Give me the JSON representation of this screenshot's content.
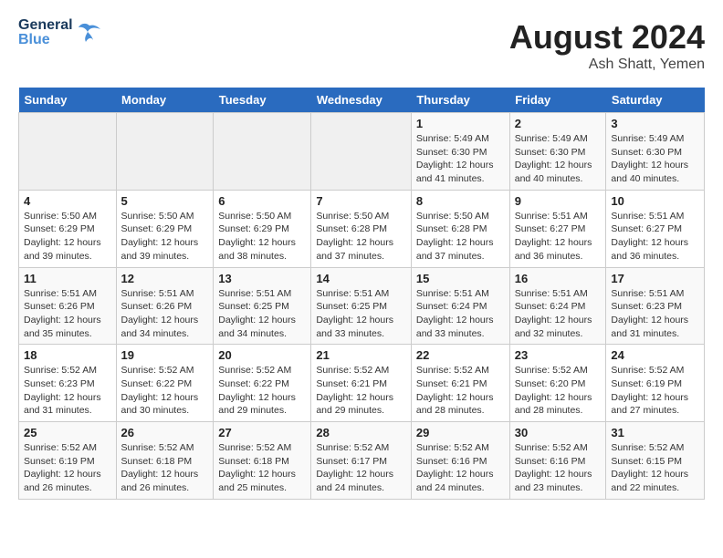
{
  "header": {
    "logo_general": "General",
    "logo_blue": "Blue",
    "month_year": "August 2024",
    "location": "Ash Shatt, Yemen"
  },
  "days_of_week": [
    "Sunday",
    "Monday",
    "Tuesday",
    "Wednesday",
    "Thursday",
    "Friday",
    "Saturday"
  ],
  "weeks": [
    [
      {
        "day": "",
        "info": ""
      },
      {
        "day": "",
        "info": ""
      },
      {
        "day": "",
        "info": ""
      },
      {
        "day": "",
        "info": ""
      },
      {
        "day": "1",
        "info": "Sunrise: 5:49 AM\nSunset: 6:30 PM\nDaylight: 12 hours\nand 41 minutes."
      },
      {
        "day": "2",
        "info": "Sunrise: 5:49 AM\nSunset: 6:30 PM\nDaylight: 12 hours\nand 40 minutes."
      },
      {
        "day": "3",
        "info": "Sunrise: 5:49 AM\nSunset: 6:30 PM\nDaylight: 12 hours\nand 40 minutes."
      }
    ],
    [
      {
        "day": "4",
        "info": "Sunrise: 5:50 AM\nSunset: 6:29 PM\nDaylight: 12 hours\nand 39 minutes."
      },
      {
        "day": "5",
        "info": "Sunrise: 5:50 AM\nSunset: 6:29 PM\nDaylight: 12 hours\nand 39 minutes."
      },
      {
        "day": "6",
        "info": "Sunrise: 5:50 AM\nSunset: 6:29 PM\nDaylight: 12 hours\nand 38 minutes."
      },
      {
        "day": "7",
        "info": "Sunrise: 5:50 AM\nSunset: 6:28 PM\nDaylight: 12 hours\nand 37 minutes."
      },
      {
        "day": "8",
        "info": "Sunrise: 5:50 AM\nSunset: 6:28 PM\nDaylight: 12 hours\nand 37 minutes."
      },
      {
        "day": "9",
        "info": "Sunrise: 5:51 AM\nSunset: 6:27 PM\nDaylight: 12 hours\nand 36 minutes."
      },
      {
        "day": "10",
        "info": "Sunrise: 5:51 AM\nSunset: 6:27 PM\nDaylight: 12 hours\nand 36 minutes."
      }
    ],
    [
      {
        "day": "11",
        "info": "Sunrise: 5:51 AM\nSunset: 6:26 PM\nDaylight: 12 hours\nand 35 minutes."
      },
      {
        "day": "12",
        "info": "Sunrise: 5:51 AM\nSunset: 6:26 PM\nDaylight: 12 hours\nand 34 minutes."
      },
      {
        "day": "13",
        "info": "Sunrise: 5:51 AM\nSunset: 6:25 PM\nDaylight: 12 hours\nand 34 minutes."
      },
      {
        "day": "14",
        "info": "Sunrise: 5:51 AM\nSunset: 6:25 PM\nDaylight: 12 hours\nand 33 minutes."
      },
      {
        "day": "15",
        "info": "Sunrise: 5:51 AM\nSunset: 6:24 PM\nDaylight: 12 hours\nand 33 minutes."
      },
      {
        "day": "16",
        "info": "Sunrise: 5:51 AM\nSunset: 6:24 PM\nDaylight: 12 hours\nand 32 minutes."
      },
      {
        "day": "17",
        "info": "Sunrise: 5:51 AM\nSunset: 6:23 PM\nDaylight: 12 hours\nand 31 minutes."
      }
    ],
    [
      {
        "day": "18",
        "info": "Sunrise: 5:52 AM\nSunset: 6:23 PM\nDaylight: 12 hours\nand 31 minutes."
      },
      {
        "day": "19",
        "info": "Sunrise: 5:52 AM\nSunset: 6:22 PM\nDaylight: 12 hours\nand 30 minutes."
      },
      {
        "day": "20",
        "info": "Sunrise: 5:52 AM\nSunset: 6:22 PM\nDaylight: 12 hours\nand 29 minutes."
      },
      {
        "day": "21",
        "info": "Sunrise: 5:52 AM\nSunset: 6:21 PM\nDaylight: 12 hours\nand 29 minutes."
      },
      {
        "day": "22",
        "info": "Sunrise: 5:52 AM\nSunset: 6:21 PM\nDaylight: 12 hours\nand 28 minutes."
      },
      {
        "day": "23",
        "info": "Sunrise: 5:52 AM\nSunset: 6:20 PM\nDaylight: 12 hours\nand 28 minutes."
      },
      {
        "day": "24",
        "info": "Sunrise: 5:52 AM\nSunset: 6:19 PM\nDaylight: 12 hours\nand 27 minutes."
      }
    ],
    [
      {
        "day": "25",
        "info": "Sunrise: 5:52 AM\nSunset: 6:19 PM\nDaylight: 12 hours\nand 26 minutes."
      },
      {
        "day": "26",
        "info": "Sunrise: 5:52 AM\nSunset: 6:18 PM\nDaylight: 12 hours\nand 26 minutes."
      },
      {
        "day": "27",
        "info": "Sunrise: 5:52 AM\nSunset: 6:18 PM\nDaylight: 12 hours\nand 25 minutes."
      },
      {
        "day": "28",
        "info": "Sunrise: 5:52 AM\nSunset: 6:17 PM\nDaylight: 12 hours\nand 24 minutes."
      },
      {
        "day": "29",
        "info": "Sunrise: 5:52 AM\nSunset: 6:16 PM\nDaylight: 12 hours\nand 24 minutes."
      },
      {
        "day": "30",
        "info": "Sunrise: 5:52 AM\nSunset: 6:16 PM\nDaylight: 12 hours\nand 23 minutes."
      },
      {
        "day": "31",
        "info": "Sunrise: 5:52 AM\nSunset: 6:15 PM\nDaylight: 12 hours\nand 22 minutes."
      }
    ]
  ]
}
